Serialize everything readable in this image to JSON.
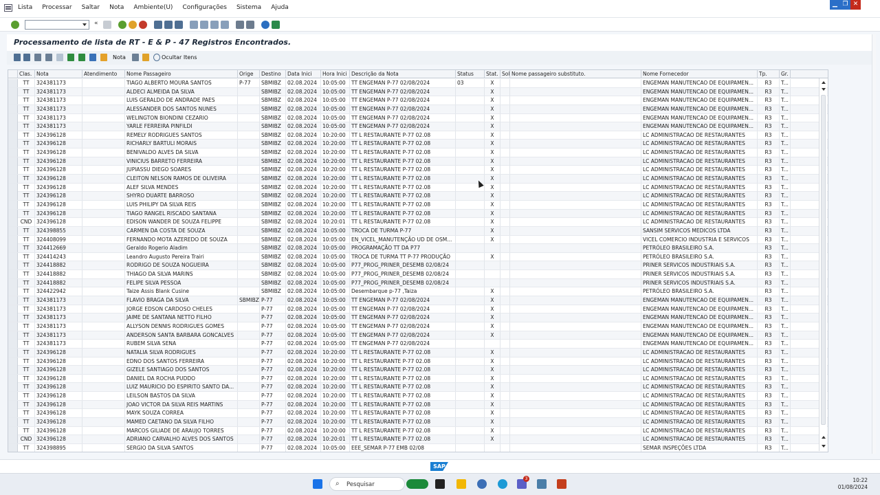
{
  "menu": [
    "Lista",
    "Processar",
    "Saltar",
    "Nota",
    "Ambiente(U)",
    "Configurações",
    "Sistema",
    "Ajuda"
  ],
  "title": "Processamento de lista de RT - E & P - 47 Registros Encontrados.",
  "app_toolbar": {
    "nota_label": "Nota",
    "ocultar_label": "Ocultar Itens"
  },
  "columns": [
    "Clas.",
    "Nota",
    "Atendimento",
    "Nome Passageiro",
    "Orige",
    "Destino",
    "Data Inici",
    "Hora Inici",
    "Descrição da Nota",
    "Status",
    "Stat.",
    "Sol",
    "Nome passageiro substituto.",
    "Nome Fornecedor",
    "Tp.",
    "Gr."
  ],
  "rows": [
    [
      "TT",
      "324381173",
      "",
      "TIAGO ALBERTO MOURA SANTOS",
      "P-77",
      "SBMIBZ",
      "02.08.2024",
      "10:05:00",
      "TT ENGEMAN P-77 02/08/2024",
      "03",
      "X",
      "",
      "",
      "ENGEMAN MANUTENCAO DE EQUIPAMEN...",
      "R3",
      "T..."
    ],
    [
      "TT",
      "324381173",
      "",
      "ALDECI ALMEIDA DA SILVA",
      "",
      "SBMIBZ",
      "02.08.2024",
      "10:05:00",
      "TT ENGEMAN P-77 02/08/2024",
      "",
      "X",
      "",
      "",
      "ENGEMAN MANUTENCAO DE EQUIPAMEN...",
      "R3",
      "T..."
    ],
    [
      "TT",
      "324381173",
      "",
      "LUIS GERALDO DE ANDRADE PAES",
      "",
      "SBMIBZ",
      "02.08.2024",
      "10:05:00",
      "TT ENGEMAN P-77 02/08/2024",
      "",
      "X",
      "",
      "",
      "ENGEMAN MANUTENCAO DE EQUIPAMEN...",
      "R3",
      "T..."
    ],
    [
      "TT",
      "324381173",
      "",
      "ALESSANDER DOS SANTOS NUNES",
      "",
      "SBMIBZ",
      "02.08.2024",
      "10:05:00",
      "TT ENGEMAN P-77 02/08/2024",
      "",
      "X",
      "",
      "",
      "ENGEMAN MANUTENCAO DE EQUIPAMEN...",
      "R3",
      "T..."
    ],
    [
      "TT",
      "324381173",
      "",
      "WELINGTON BIONDINI CEZARIO",
      "",
      "SBMIBZ",
      "02.08.2024",
      "10:05:00",
      "TT ENGEMAN P-77 02/08/2024",
      "",
      "X",
      "",
      "",
      "ENGEMAN MANUTENCAO DE EQUIPAMEN...",
      "R3",
      "T..."
    ],
    [
      "TT",
      "324381173",
      "",
      "YARLE FERREIRA PINFILDI",
      "",
      "SBMIBZ",
      "02.08.2024",
      "10:05:00",
      "TT ENGEMAN P-77 02/08/2024",
      "",
      "X",
      "",
      "",
      "ENGEMAN MANUTENCAO DE EQUIPAMEN...",
      "R3",
      "T..."
    ],
    [
      "TT",
      "324396128",
      "",
      "REMELY RODRIGUES SANTOS",
      "",
      "SBMIBZ",
      "02.08.2024",
      "10:20:00",
      "TT L RESTAURANTE P-77 02.08",
      "",
      "X",
      "",
      "",
      "LC ADMINISTRACAO DE RESTAURANTES",
      "R3",
      "T..."
    ],
    [
      "TT",
      "324396128",
      "",
      "RICHARLY BARTULI MORAIS",
      "",
      "SBMIBZ",
      "02.08.2024",
      "10:20:00",
      "TT L RESTAURANTE P-77 02.08",
      "",
      "X",
      "",
      "",
      "LC ADMINISTRACAO DE RESTAURANTES",
      "R3",
      "T..."
    ],
    [
      "TT",
      "324396128",
      "",
      "BENIVALDO ALVES DA SILVA",
      "",
      "SBMIBZ",
      "02.08.2024",
      "10:20:00",
      "TT L RESTAURANTE P-77 02.08",
      "",
      "X",
      "",
      "",
      "LC ADMINISTRACAO DE RESTAURANTES",
      "R3",
      "T..."
    ],
    [
      "TT",
      "324396128",
      "",
      "VINICIUS BARRETO FERREIRA",
      "",
      "SBMIBZ",
      "02.08.2024",
      "10:20:00",
      "TT L RESTAURANTE P-77 02.08",
      "",
      "X",
      "",
      "",
      "LC ADMINISTRACAO DE RESTAURANTES",
      "R3",
      "T..."
    ],
    [
      "TT",
      "324396128",
      "",
      "JUPIASSU DIEGO SOARES",
      "",
      "SBMIBZ",
      "02.08.2024",
      "10:20:00",
      "TT L RESTAURANTE P-77 02.08",
      "",
      "X",
      "",
      "",
      "LC ADMINISTRACAO DE RESTAURANTES",
      "R3",
      "T..."
    ],
    [
      "TT",
      "324396128",
      "",
      "CLEITON NELSON RAMOS DE OLIVEIRA",
      "",
      "SBMIBZ",
      "02.08.2024",
      "10:20:00",
      "TT L RESTAURANTE P-77 02.08",
      "",
      "X",
      "",
      "",
      "LC ADMINISTRACAO DE RESTAURANTES",
      "R3",
      "T..."
    ],
    [
      "TT",
      "324396128",
      "",
      "ALEF SILVA MENDES",
      "",
      "SBMIBZ",
      "02.08.2024",
      "10:20:00",
      "TT L RESTAURANTE P-77 02.08",
      "",
      "X",
      "",
      "",
      "LC ADMINISTRACAO DE RESTAURANTES",
      "R3",
      "T..."
    ],
    [
      "TT",
      "324396128",
      "",
      "SHYRO DUARTE BARROSO",
      "",
      "SBMIBZ",
      "02.08.2024",
      "10:20:00",
      "TT L RESTAURANTE P-77 02.08",
      "",
      "X",
      "",
      "",
      "LC ADMINISTRACAO DE RESTAURANTES",
      "R3",
      "T..."
    ],
    [
      "TT",
      "324396128",
      "",
      "LUIS PHILIPY DA SILVA REIS",
      "",
      "SBMIBZ",
      "02.08.2024",
      "10:20:00",
      "TT L RESTAURANTE P-77 02.08",
      "",
      "X",
      "",
      "",
      "LC ADMINISTRACAO DE RESTAURANTES",
      "R3",
      "T..."
    ],
    [
      "TT",
      "324396128",
      "",
      "TIAGO RANGEL RISCADO SANTANA",
      "",
      "SBMIBZ",
      "02.08.2024",
      "10:20:00",
      "TT L RESTAURANTE P-77 02.08",
      "",
      "X",
      "",
      "",
      "LC ADMINISTRACAO DE RESTAURANTES",
      "R3",
      "T..."
    ],
    [
      "CND",
      "324396128",
      "",
      "EDISON WANDER DE SOUZA FELIPPE",
      "",
      "SBMIBZ",
      "02.08.2024",
      "10:20:01",
      "TT L RESTAURANTE P-77 02.08",
      "",
      "X",
      "",
      "",
      "LC ADMINISTRACAO DE RESTAURANTES",
      "R3",
      "T..."
    ],
    [
      "TT",
      "324398855",
      "",
      "CARMEN DA COSTA DE SOUZA",
      "",
      "SBMIBZ",
      "02.08.2024",
      "10:05:00",
      "TROCA DE TURMA P-77",
      "",
      "X",
      "",
      "",
      "SANSIM SERVICOS MEDICOS LTDA",
      "R3",
      "T..."
    ],
    [
      "TT",
      "324408099",
      "",
      "FERNANDO MOTA AZEREDO DE SOUZA",
      "",
      "SBMIBZ",
      "02.08.2024",
      "10:05:00",
      "EN_VICEL_MANUTENÇÃO UD DE OSM...",
      "",
      "X",
      "",
      "",
      "VICEL COMERCIO INDUSTRIA E SERVICOS",
      "R3",
      "T..."
    ],
    [
      "TT",
      "324412669",
      "",
      "Geraldo Rogerio Aladim",
      "",
      "SBMIBZ",
      "02.08.2024",
      "10:05:00",
      "PROGRAMAÇÃO TT DA P77",
      "",
      "",
      "",
      "",
      "PETRÓLEO BRASILEIRO S.A.",
      "R3",
      "T..."
    ],
    [
      "TT",
      "324414243",
      "",
      "Leandro Augusto Pereira Trairi",
      "",
      "SBMIBZ",
      "02.08.2024",
      "10:05:00",
      "TROCA DE TURMA TT P-77 PRODUÇÃO",
      "",
      "X",
      "",
      "",
      "PETRÓLEO BRASILEIRO S.A.",
      "R3",
      "T..."
    ],
    [
      "TT",
      "324418882",
      "",
      "RODRIGO DE SOUZA NOGUEIRA",
      "",
      "SBMIBZ",
      "02.08.2024",
      "10:05:00",
      "P77_PROG_PRINER_DESEMB 02/08/24",
      "",
      "",
      "",
      "",
      "PRINER SERVICOS INDUSTRIAIS S.A.",
      "R3",
      "T..."
    ],
    [
      "TT",
      "324418882",
      "",
      "THIAGO DA SILVA MARINS",
      "",
      "SBMIBZ",
      "02.08.2024",
      "10:05:00",
      "P77_PROG_PRINER_DESEMB 02/08/24",
      "",
      "",
      "",
      "",
      "PRINER SERVICOS INDUSTRIAIS S.A.",
      "R3",
      "T..."
    ],
    [
      "TT",
      "324418882",
      "",
      "FELIPE SILVA PESSOA",
      "",
      "SBMIBZ",
      "02.08.2024",
      "10:05:00",
      "P77_PROG_PRINER_DESEMB 02/08/24",
      "",
      "",
      "",
      "",
      "PRINER SERVICOS INDUSTRIAIS S.A.",
      "R3",
      "T..."
    ],
    [
      "TT",
      "324422942",
      "",
      "Taize Assis Blank Cusine",
      "",
      "SBMIBZ",
      "02.08.2024",
      "10:05:00",
      "Desembarque p-77 ,Taiza",
      "",
      "X",
      "",
      "",
      "PETRÓLEO BRASILEIRO S.A.",
      "R3",
      "T..."
    ],
    [
      "TT",
      "324381173",
      "",
      "FLAVIO BRAGA DA SILVA",
      "SBMIBZ",
      "P-77",
      "02.08.2024",
      "10:05:00",
      "TT ENGEMAN P-77 02/08/2024",
      "",
      "X",
      "",
      "",
      "ENGEMAN MANUTENCAO DE EQUIPAMEN...",
      "R3",
      "T..."
    ],
    [
      "TT",
      "324381173",
      "",
      "JORGE EDSON CARDOSO CHELES",
      "",
      "P-77",
      "02.08.2024",
      "10:05:00",
      "TT ENGEMAN P-77 02/08/2024",
      "",
      "X",
      "",
      "",
      "ENGEMAN MANUTENCAO DE EQUIPAMEN...",
      "R3",
      "T..."
    ],
    [
      "TT",
      "324381173",
      "",
      "JAIME DE SANTANA NETTO FILHO",
      "",
      "P-77",
      "02.08.2024",
      "10:05:00",
      "TT ENGEMAN P-77 02/08/2024",
      "",
      "X",
      "",
      "",
      "ENGEMAN MANUTENCAO DE EQUIPAMEN...",
      "R3",
      "T..."
    ],
    [
      "TT",
      "324381173",
      "",
      "ALLYSON DENNIS RODRIGUES GOMES",
      "",
      "P-77",
      "02.08.2024",
      "10:05:00",
      "TT ENGEMAN P-77 02/08/2024",
      "",
      "X",
      "",
      "",
      "ENGEMAN MANUTENCAO DE EQUIPAMEN...",
      "R3",
      "T..."
    ],
    [
      "TT",
      "324381173",
      "",
      "ANDERSON SANTA BARBARA GONCALVES",
      "",
      "P-77",
      "02.08.2024",
      "10:05:00",
      "TT ENGEMAN P-77 02/08/2024",
      "",
      "X",
      "",
      "",
      "ENGEMAN MANUTENCAO DE EQUIPAMEN...",
      "R3",
      "T..."
    ],
    [
      "TT",
      "324381173",
      "",
      "RUBEM SILVA SENA",
      "",
      "P-77",
      "02.08.2024",
      "10:05:00",
      "TT ENGEMAN P-77 02/08/2024",
      "",
      "",
      "",
      "",
      "ENGEMAN MANUTENCAO DE EQUIPAMEN...",
      "R3",
      "T..."
    ],
    [
      "TT",
      "324396128",
      "",
      "NATALIA SILVA RODRIGUES",
      "",
      "P-77",
      "02.08.2024",
      "10:20:00",
      "TT L RESTAURANTE P-77 02.08",
      "",
      "X",
      "",
      "",
      "LC ADMINISTRACAO DE RESTAURANTES",
      "R3",
      "T..."
    ],
    [
      "TT",
      "324396128",
      "",
      "EDNO DOS SANTOS FERREIRA",
      "",
      "P-77",
      "02.08.2024",
      "10:20:00",
      "TT L RESTAURANTE P-77 02.08",
      "",
      "X",
      "",
      "",
      "LC ADMINISTRACAO DE RESTAURANTES",
      "R3",
      "T..."
    ],
    [
      "TT",
      "324396128",
      "",
      "GIZELE SANTIAGO DOS SANTOS",
      "",
      "P-77",
      "02.08.2024",
      "10:20:00",
      "TT L RESTAURANTE P-77 02.08",
      "",
      "X",
      "",
      "",
      "LC ADMINISTRACAO DE RESTAURANTES",
      "R3",
      "T..."
    ],
    [
      "TT",
      "324396128",
      "",
      "DANIEL DA ROCHA PUDDO",
      "",
      "P-77",
      "02.08.2024",
      "10:20:00",
      "TT L RESTAURANTE P-77 02.08",
      "",
      "X",
      "",
      "",
      "LC ADMINISTRACAO DE RESTAURANTES",
      "R3",
      "T..."
    ],
    [
      "TT",
      "324396128",
      "",
      "LUIZ MAURICIO DO ESPIRITO SANTO DA...",
      "",
      "P-77",
      "02.08.2024",
      "10:20:00",
      "TT L RESTAURANTE P-77 02.08",
      "",
      "X",
      "",
      "",
      "LC ADMINISTRACAO DE RESTAURANTES",
      "R3",
      "T..."
    ],
    [
      "TT",
      "324396128",
      "",
      "LEILSON BASTOS DA SILVA",
      "",
      "P-77",
      "02.08.2024",
      "10:20:00",
      "TT L RESTAURANTE P-77 02.08",
      "",
      "X",
      "",
      "",
      "LC ADMINISTRACAO DE RESTAURANTES",
      "R3",
      "T..."
    ],
    [
      "TT",
      "324396128",
      "",
      "JOAO VICTOR DA SILVA REIS MARTINS",
      "",
      "P-77",
      "02.08.2024",
      "10:20:00",
      "TT L RESTAURANTE P-77 02.08",
      "",
      "X",
      "",
      "",
      "LC ADMINISTRACAO DE RESTAURANTES",
      "R3",
      "T..."
    ],
    [
      "TT",
      "324396128",
      "",
      "MAYK SOUZA CORREA",
      "",
      "P-77",
      "02.08.2024",
      "10:20:00",
      "TT L RESTAURANTE P-77 02.08",
      "",
      "X",
      "",
      "",
      "LC ADMINISTRACAO DE RESTAURANTES",
      "R3",
      "T..."
    ],
    [
      "TT",
      "324396128",
      "",
      "MAMED CAETANO DA SILVA FILHO",
      "",
      "P-77",
      "02.08.2024",
      "10:20:00",
      "TT L RESTAURANTE P-77 02.08",
      "",
      "X",
      "",
      "",
      "LC ADMINISTRACAO DE RESTAURANTES",
      "R3",
      "T..."
    ],
    [
      "TT",
      "324396128",
      "",
      "MARCOS GILIADE DE ARAUJO TORRES",
      "",
      "P-77",
      "02.08.2024",
      "10:20:00",
      "TT L RESTAURANTE P-77 02.08",
      "",
      "X",
      "",
      "",
      "LC ADMINISTRACAO DE RESTAURANTES",
      "R3",
      "T..."
    ],
    [
      "CND",
      "324396128",
      "",
      "ADRIANO CARVALHO ALVES DOS SANTOS",
      "",
      "P-77",
      "02.08.2024",
      "10:20:01",
      "TT L RESTAURANTE P-77 02.08",
      "",
      "X",
      "",
      "",
      "LC ADMINISTRACAO DE RESTAURANTES",
      "R3",
      "T..."
    ],
    [
      "TT",
      "324398895",
      "",
      "SERGIO DA SILVA SANTOS",
      "",
      "P-77",
      "02.08.2024",
      "10:05:00",
      "EEE_SEMAR P-77 EMB 02/08",
      "",
      "",
      "",
      "",
      "SEMAR INSPEÇÕES LTDA",
      "R3",
      "T..."
    ]
  ],
  "status_logo": "SAP",
  "taskbar": {
    "search_label": "Pesquisar",
    "time": "10:22",
    "date": "01/08/2024",
    "teams_badge": "3"
  },
  "colors": {
    "accent": "#1a7fd2",
    "close_red": "#c42b1c",
    "sap_blue": "#1a7fd2"
  }
}
